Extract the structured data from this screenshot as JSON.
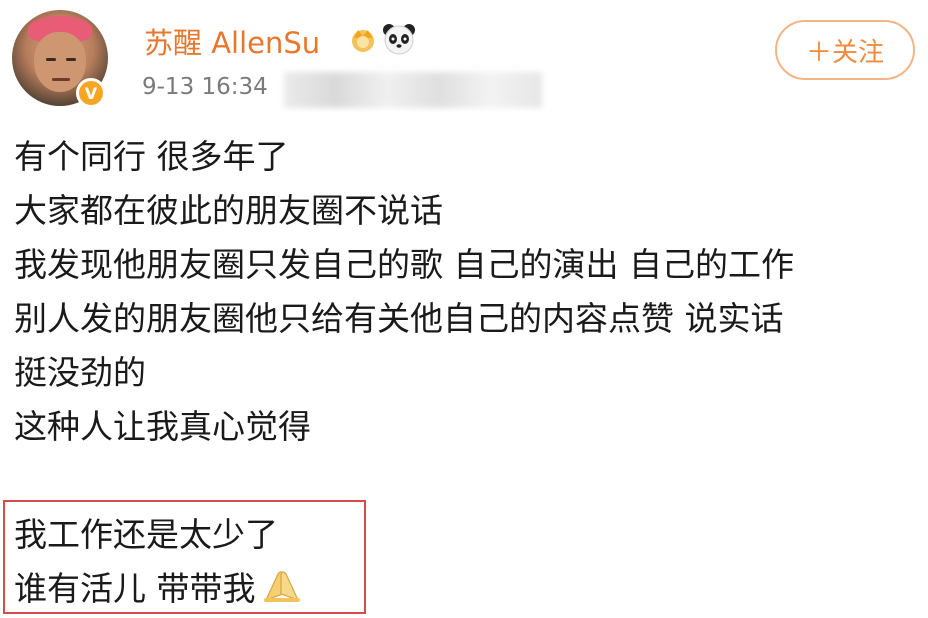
{
  "user": {
    "name": "苏醒 AllenSu",
    "verified_badge": "V",
    "badge_icons": [
      "crown-icon",
      "panda-icon"
    ]
  },
  "post": {
    "timestamp": "9-13 16:34",
    "lines": [
      "有个同行 很多年了",
      "大家都在彼此的朋友圈不说话",
      "我发现他朋友圈只发自己的歌 自己的演出 自己的工作",
      "别人发的朋友圈他只给有关他自己的内容点赞 说实话",
      "挺没劲的",
      "这种人让我真心觉得",
      "",
      "我工作还是太少了",
      "谁有活儿 带带我"
    ],
    "end_emoji": "praying-hands-icon"
  },
  "actions": {
    "follow_label": "＋关注"
  },
  "colors": {
    "username": "#e8772e",
    "follow_border": "#f5b485",
    "follow_text": "#f08a3c",
    "highlight_box": "#d94a4a",
    "verified_badge": "#f6a623"
  }
}
